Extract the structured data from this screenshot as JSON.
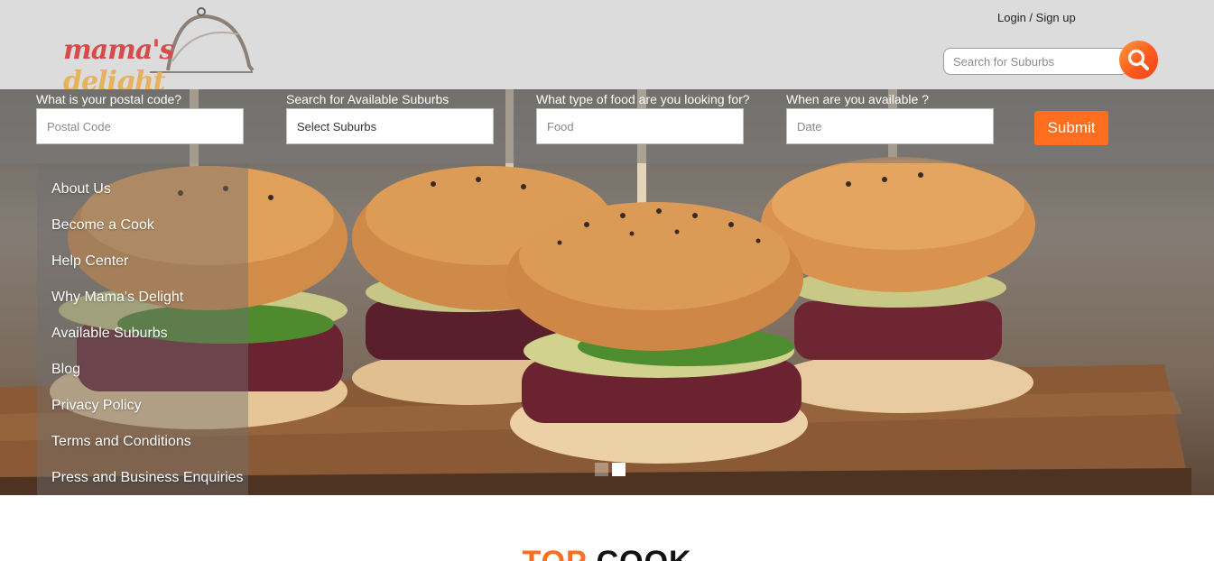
{
  "header": {
    "logo_text_1": "mama's",
    "logo_text_2": "delight",
    "login_label": "Login / Sign up",
    "search_placeholder": "Search for Suburbs"
  },
  "search_form": {
    "postal": {
      "label": "What is your postal code?",
      "placeholder": "Postal Code"
    },
    "suburbs": {
      "label": "Search for Available Suburbs",
      "value": "Select Suburbs"
    },
    "food": {
      "label": "What type of food are you looking for?",
      "placeholder": "Food"
    },
    "date": {
      "label": "When are you available ?",
      "placeholder": "Date"
    },
    "submit_label": "Submit"
  },
  "side_menu": {
    "items": [
      "About Us",
      "Become a Cook",
      "Help Center",
      "Why Mama's Delight",
      "Available Suburbs",
      "Blog",
      "Privacy Policy",
      "Terms and Conditions",
      "Press and Business Enquiries"
    ]
  },
  "carousel": {
    "slide_count": 2,
    "active_slide": 2
  },
  "section": {
    "title_part1": "TOP",
    "title_part2": "COOK"
  },
  "colors": {
    "accent": "#ff6d1f",
    "header_bg": "#dcdcdc",
    "logo_red": "#d94a4a",
    "logo_gold": "#e6b35c"
  },
  "icons": {
    "search_button": "search-icon",
    "logo_cloche": "cloche-icon"
  }
}
